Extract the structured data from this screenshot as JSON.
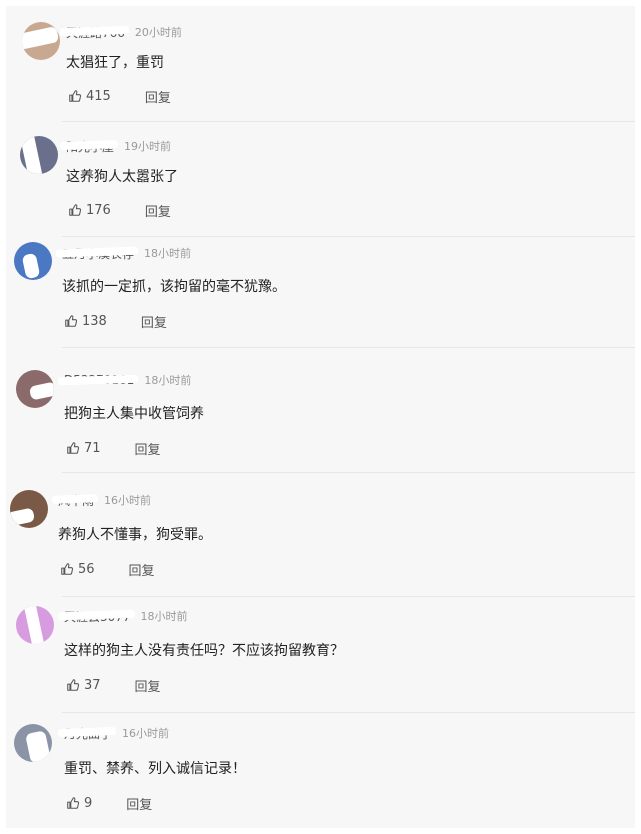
{
  "colors": {
    "panel_bg": "#f7f7f8",
    "divider": "#e6e6e6",
    "meta_text": "#9a9a9a"
  },
  "comments": [
    {
      "name": "天涯路766",
      "time": "20小时前",
      "text": "太猖狂了，重罚",
      "likes": "415",
      "reply_label": "回复"
    },
    {
      "name": "阳光小屋",
      "time": "19小时前",
      "text": "这养狗人太嚣张了",
      "likes": "176",
      "reply_label": "回复"
    },
    {
      "name": "五月小溪长存",
      "time": "18小时前",
      "text": "该抓的一定抓，该拘留的毫不犹豫。",
      "likes": "138",
      "reply_label": "回复"
    },
    {
      "name": "D53270161",
      "time": "18小时前",
      "text": "把狗主人集中收管饲养",
      "likes": "71",
      "reply_label": "回复"
    },
    {
      "name": "风中雨",
      "time": "16小时前",
      "text": "养狗人不懂事，狗受罪。",
      "likes": "56",
      "reply_label": "回复"
    },
    {
      "name": "天涯云3077",
      "time": "18小时前",
      "text": "这样的狗主人没有责任吗？不应该拘留教育？",
      "likes": "37",
      "reply_label": "回复"
    },
    {
      "name": "月光曲子",
      "time": "16小时前",
      "text": "重罚、禁养、列入诚信记录！",
      "likes": "9",
      "reply_label": "回复"
    }
  ]
}
